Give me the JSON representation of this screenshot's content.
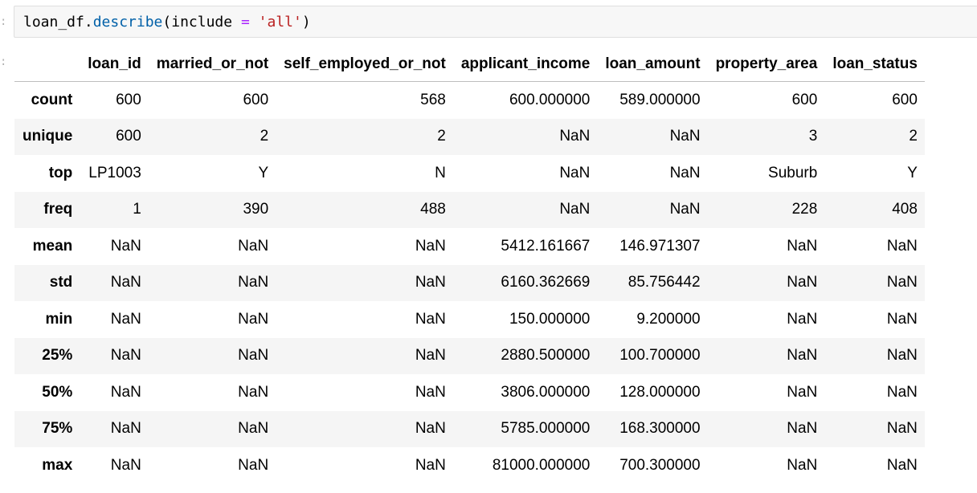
{
  "prompt_char": ":",
  "code": {
    "obj": "loan_df",
    "dot": ".",
    "method": "describe",
    "open_paren": "(",
    "kwarg": "include ",
    "eq": "=",
    "space": " ",
    "str": "'all'",
    "close_paren": ")"
  },
  "table": {
    "index_header": "",
    "columns": [
      "loan_id",
      "married_or_not",
      "self_employed_or_not",
      "applicant_income",
      "loan_amount",
      "property_area",
      "loan_status"
    ],
    "rows": [
      {
        "label": "count",
        "cells": [
          "600",
          "600",
          "568",
          "600.000000",
          "589.000000",
          "600",
          "600"
        ]
      },
      {
        "label": "unique",
        "cells": [
          "600",
          "2",
          "2",
          "NaN",
          "NaN",
          "3",
          "2"
        ]
      },
      {
        "label": "top",
        "cells": [
          "LP1003",
          "Y",
          "N",
          "NaN",
          "NaN",
          "Suburb",
          "Y"
        ]
      },
      {
        "label": "freq",
        "cells": [
          "1",
          "390",
          "488",
          "NaN",
          "NaN",
          "228",
          "408"
        ]
      },
      {
        "label": "mean",
        "cells": [
          "NaN",
          "NaN",
          "NaN",
          "5412.161667",
          "146.971307",
          "NaN",
          "NaN"
        ]
      },
      {
        "label": "std",
        "cells": [
          "NaN",
          "NaN",
          "NaN",
          "6160.362669",
          "85.756442",
          "NaN",
          "NaN"
        ]
      },
      {
        "label": "min",
        "cells": [
          "NaN",
          "NaN",
          "NaN",
          "150.000000",
          "9.200000",
          "NaN",
          "NaN"
        ]
      },
      {
        "label": "25%",
        "cells": [
          "NaN",
          "NaN",
          "NaN",
          "2880.500000",
          "100.700000",
          "NaN",
          "NaN"
        ]
      },
      {
        "label": "50%",
        "cells": [
          "NaN",
          "NaN",
          "NaN",
          "3806.000000",
          "128.000000",
          "NaN",
          "NaN"
        ]
      },
      {
        "label": "75%",
        "cells": [
          "NaN",
          "NaN",
          "NaN",
          "5785.000000",
          "168.300000",
          "NaN",
          "NaN"
        ]
      },
      {
        "label": "max",
        "cells": [
          "NaN",
          "NaN",
          "NaN",
          "81000.000000",
          "700.300000",
          "NaN",
          "NaN"
        ]
      }
    ]
  }
}
